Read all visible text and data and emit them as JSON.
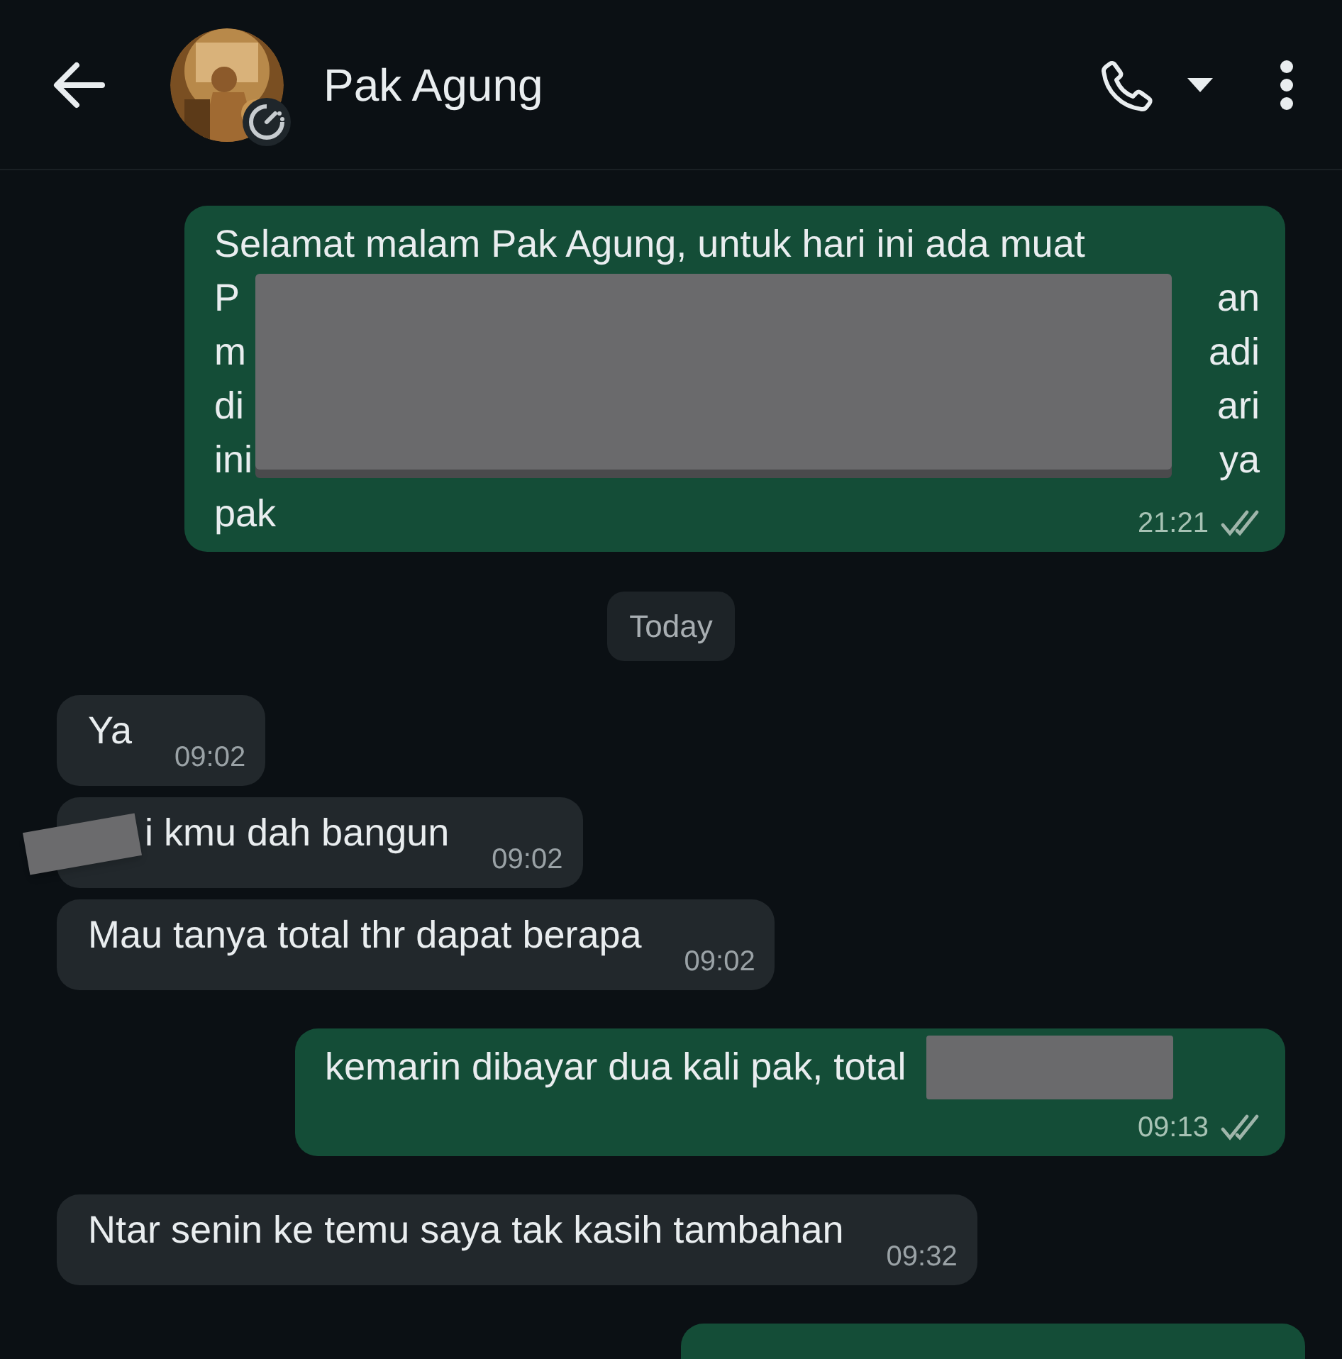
{
  "header": {
    "name": "Pak Agung"
  },
  "messages": [
    {
      "kind": "outgoing",
      "covered": true,
      "lines": [
        {
          "left": "Selamat malam Pak Agung, untuk hari ini ada muat"
        },
        {
          "left": "P",
          "right": "an"
        },
        {
          "left": "m",
          "right": "adi"
        },
        {
          "left": "di",
          "right": "ari"
        },
        {
          "left": "ini",
          "right": "ya"
        },
        {
          "left": "pak"
        }
      ],
      "time": "21:21",
      "read": false
    },
    {
      "kind": "date",
      "text": "Today"
    },
    {
      "kind": "incoming",
      "text": "Ya",
      "time": "09:02",
      "covered": false
    },
    {
      "kind": "incoming",
      "text": "i kmu dah bangun",
      "time": "09:02",
      "covered": true
    },
    {
      "kind": "incoming",
      "text": "Mau tanya total thr dapat berapa",
      "time": "09:02",
      "covered": false
    },
    {
      "kind": "outgoing",
      "text": "kemarin dibayar dua kali pak, total",
      "covered": true,
      "time": "09:13",
      "read": false
    },
    {
      "kind": "incoming",
      "text": "Ntar senin ke temu saya tak kasih tambahan",
      "time": "09:32",
      "covered": false
    },
    {
      "kind": "outgoing_cut"
    }
  ]
}
